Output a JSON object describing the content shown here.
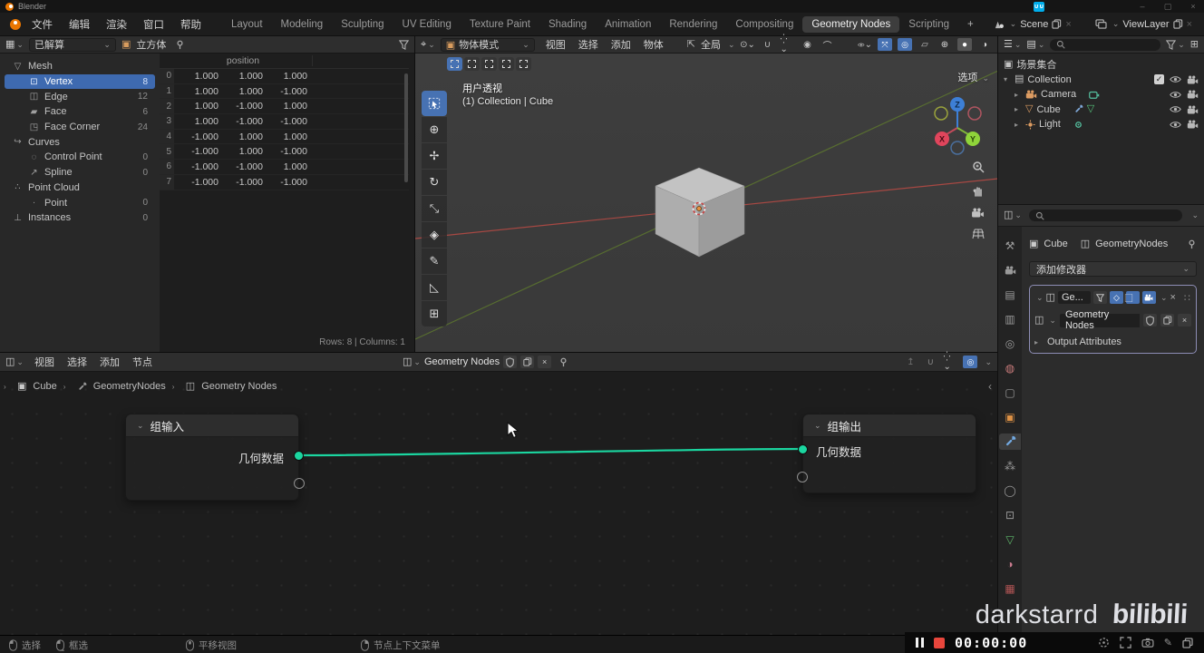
{
  "window": {
    "title": "Blender",
    "controls": {
      "minimize": "–",
      "maximize": "▢",
      "close": "×"
    }
  },
  "topbar": {
    "menus": [
      "文件",
      "编辑",
      "渲染",
      "窗口",
      "帮助"
    ],
    "workspaces": [
      "Layout",
      "Modeling",
      "Sculpting",
      "UV Editing",
      "Texture Paint",
      "Shading",
      "Animation",
      "Rendering",
      "Compositing",
      "Geometry Nodes",
      "Scripting"
    ],
    "active_workspace": "Geometry Nodes",
    "add_workspace": "+",
    "scene_label": "Scene",
    "view_layer_label": "ViewLayer"
  },
  "spreadsheet": {
    "evaluated_label": "已解算",
    "object_label": "立方体",
    "tree": [
      {
        "label": "Mesh",
        "count": ""
      },
      {
        "label": "Vertex",
        "count": "8"
      },
      {
        "label": "Edge",
        "count": "12"
      },
      {
        "label": "Face",
        "count": "6"
      },
      {
        "label": "Face Corner",
        "count": "24"
      },
      {
        "label": "Curves",
        "count": ""
      },
      {
        "label": "Control Point",
        "count": "0"
      },
      {
        "label": "Spline",
        "count": "0"
      },
      {
        "label": "Point Cloud",
        "count": ""
      },
      {
        "label": "Point",
        "count": "0"
      },
      {
        "label": "Instances",
        "count": "0"
      }
    ],
    "table": {
      "group_header": "position",
      "rows": [
        {
          "index": "0",
          "values": [
            "1.000",
            "1.000",
            "1.000"
          ]
        },
        {
          "index": "1",
          "values": [
            "1.000",
            "1.000",
            "-1.000"
          ]
        },
        {
          "index": "2",
          "values": [
            "1.000",
            "-1.000",
            "1.000"
          ]
        },
        {
          "index": "3",
          "values": [
            "1.000",
            "-1.000",
            "-1.000"
          ]
        },
        {
          "index": "4",
          "values": [
            "-1.000",
            "1.000",
            "1.000"
          ]
        },
        {
          "index": "5",
          "values": [
            "-1.000",
            "1.000",
            "-1.000"
          ]
        },
        {
          "index": "6",
          "values": [
            "-1.000",
            "-1.000",
            "1.000"
          ]
        },
        {
          "index": "7",
          "values": [
            "-1.000",
            "-1.000",
            "-1.000"
          ]
        }
      ]
    },
    "footer": "Rows: 8   |   Columns: 1"
  },
  "viewport": {
    "mode": "物体模式",
    "menus": [
      "视图",
      "选择",
      "添加",
      "物体"
    ],
    "orientation": "全局",
    "options_label": "选项",
    "overlay_title": "用户透视",
    "overlay_subtitle": "(1) Collection | Cube",
    "gizmo": {
      "x": "X",
      "y": "Y",
      "z": "Z"
    }
  },
  "outliner": {
    "scene_collection": "场景集合",
    "collection": "Collection",
    "items": [
      {
        "label": "Camera"
      },
      {
        "label": "Cube"
      },
      {
        "label": "Light"
      }
    ]
  },
  "properties": {
    "breadcrumb_object": "Cube",
    "breadcrumb_modifier": "GeometryNodes",
    "add_modifier_label": "添加修改器",
    "modifier_name_short": "Ge...",
    "node_group_name": "Geometry Nodes",
    "output_attributes_label": "Output Attributes"
  },
  "node_editor": {
    "menus": [
      "视图",
      "选择",
      "添加",
      "节点"
    ],
    "tree_name": "Geometry Nodes",
    "breadcrumb": [
      "Cube",
      "GeometryNodes",
      "Geometry Nodes"
    ],
    "group_input": {
      "title": "组输入",
      "socket_label": "几何数据"
    },
    "group_output": {
      "title": "组输出",
      "socket_label": "几何数据"
    }
  },
  "statusbar": {
    "hints": [
      {
        "label": "选择"
      },
      {
        "label": "框选"
      },
      {
        "label": "平移视图"
      },
      {
        "label": "节点上下文菜单"
      }
    ]
  },
  "recorder": {
    "time": "00:00:00"
  },
  "watermark": {
    "name": "darkstarrd",
    "logo": "bilibili"
  },
  "colors": {
    "accent_blue": "#4772b3",
    "socket_green": "#1bd6a0",
    "record_red": "#e8463c",
    "blender_orange": "#ea7600",
    "bilibili_teal": "#00aeec"
  }
}
